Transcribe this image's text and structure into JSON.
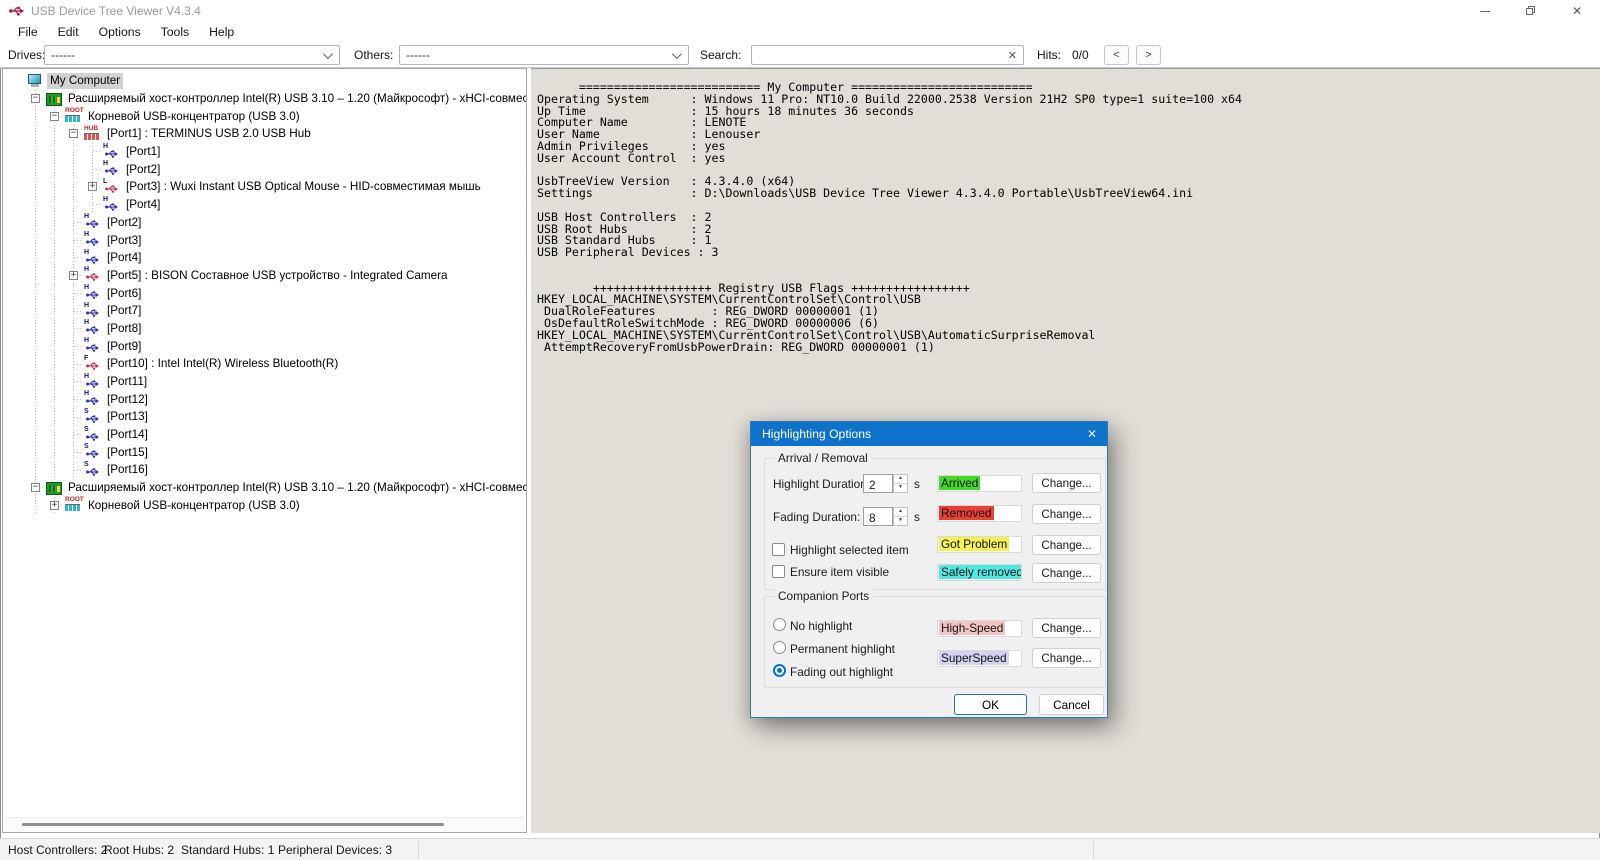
{
  "window": {
    "title": "USB Device Tree Viewer V4.3.4"
  },
  "menu": [
    "File",
    "Edit",
    "Options",
    "Tools",
    "Help"
  ],
  "toolbar": {
    "drives_label": "Drives:",
    "drives_value": "------",
    "others_label": "Others:",
    "others_value": "------",
    "search_label": "Search:",
    "search_value": "",
    "clear_icon": "✕",
    "hits_label": "Hits:",
    "hits_value": "0/0",
    "prev_label": "<",
    "next_label": ">"
  },
  "tree": {
    "items": [
      {
        "level": 0,
        "icon": "computer",
        "expand": null,
        "label": "My Computer",
        "selected": true
      },
      {
        "level": 1,
        "icon": "host-controller",
        "expand": "-",
        "label": "Расширяемый хост-контроллер Intel(R) USB 3.10 – 1.20 (Майкрософт) - xHCI-совместимый хо"
      },
      {
        "level": 2,
        "icon": "root-hub",
        "expand": "-",
        "label": "Корневой USB-концентратор (USB 3.0)"
      },
      {
        "level": 3,
        "icon": "hub",
        "expand": "-",
        "label": "[Port1] : TERMINUS USB 2.0 USB Hub"
      },
      {
        "level": 4,
        "icon": "port-h",
        "expand": null,
        "label": "[Port1]"
      },
      {
        "level": 4,
        "icon": "port-h",
        "expand": null,
        "label": "[Port2]"
      },
      {
        "level": 4,
        "icon": "port-l-device",
        "expand": "+",
        "label": "[Port3] : Wuxi Instant USB Optical Mouse - HID-совместимая мышь"
      },
      {
        "level": 4,
        "icon": "port-h",
        "expand": null,
        "label": "[Port4]"
      },
      {
        "level": 3,
        "icon": "port-h",
        "expand": null,
        "label": "[Port2]"
      },
      {
        "level": 3,
        "icon": "port-h",
        "expand": null,
        "label": "[Port3]"
      },
      {
        "level": 3,
        "icon": "port-h",
        "expand": null,
        "label": "[Port4]"
      },
      {
        "level": 3,
        "icon": "port-h-device",
        "expand": "+",
        "label": "[Port5] : BISON Составное USB устройство - Integrated Camera"
      },
      {
        "level": 3,
        "icon": "port-h",
        "expand": null,
        "label": "[Port6]"
      },
      {
        "level": 3,
        "icon": "port-h",
        "expand": null,
        "label": "[Port7]"
      },
      {
        "level": 3,
        "icon": "port-h",
        "expand": null,
        "label": "[Port8]"
      },
      {
        "level": 3,
        "icon": "port-h",
        "expand": null,
        "label": "[Port9]"
      },
      {
        "level": 3,
        "icon": "port-f-device",
        "expand": null,
        "label": "[Port10] : Intel Intel(R) Wireless Bluetooth(R)"
      },
      {
        "level": 3,
        "icon": "port-h",
        "expand": null,
        "label": "[Port11]"
      },
      {
        "level": 3,
        "icon": "port-h",
        "expand": null,
        "label": "[Port12]"
      },
      {
        "level": 3,
        "icon": "port-s",
        "expand": null,
        "label": "[Port13]"
      },
      {
        "level": 3,
        "icon": "port-s",
        "expand": null,
        "label": "[Port14]"
      },
      {
        "level": 3,
        "icon": "port-s",
        "expand": null,
        "label": "[Port15]"
      },
      {
        "level": 3,
        "icon": "port-s",
        "expand": null,
        "label": "[Port16]"
      },
      {
        "level": 1,
        "icon": "host-controller",
        "expand": "-",
        "label": "Расширяемый хост-контроллер Intel(R) USB 3.10 – 1.20 (Майкрософт) - xHCI-совместимый хо"
      },
      {
        "level": 2,
        "icon": "root-hub",
        "expand": "+",
        "label": "Корневой USB-концентратор (USB 3.0)"
      }
    ]
  },
  "terminal": {
    "lines": [
      "      ========================== My Computer ==========================",
      "Operating System      : Windows 11 Pro: NT10.0 Build 22000.2538 Version 21H2 SP0 type=1 suite=100 x64",
      "Up Time               : 15 hours 18 minutes 36 seconds",
      "Computer Name         : LENOTE",
      "User Name             : Lenouser",
      "Admin Privileges      : yes",
      "User Account Control  : yes",
      "",
      "UsbTreeView Version   : 4.3.4.0 (x64)",
      "Settings              : D:\\Downloads\\USB Device Tree Viewer 4.3.4.0 Portable\\UsbTreeView64.ini",
      "",
      "USB Host Controllers  : 2",
      "USB Root Hubs         : 2",
      "USB Standard Hubs     : 1",
      "USB Peripheral Devices : 3",
      "",
      "",
      "        +++++++++++++++++ Registry USB Flags +++++++++++++++++",
      "HKEY_LOCAL_MACHINE\\SYSTEM\\CurrentControlSet\\Control\\USB",
      " DualRoleFeatures        : REG_DWORD 00000001 (1)",
      " OsDefaultRoleSwitchMode : REG_DWORD 00000006 (6)",
      "HKEY_LOCAL_MACHINE\\SYSTEM\\CurrentControlSet\\Control\\USB\\AutomaticSurpriseRemoval",
      " AttemptRecoveryFromUsbPowerDrain: REG_DWORD 00000001 (1)"
    ]
  },
  "dialog": {
    "title": "Highlighting Options",
    "close_icon": "✕",
    "group1": "Arrival / Removal",
    "group2": "Companion Ports",
    "highlight_duration_label": "Highlight Duration:",
    "highlight_duration_value": "2",
    "fading_duration_label": "Fading Duration:",
    "fading_duration_value": "8",
    "seconds_suffix": "s",
    "checkboxes": [
      {
        "label": "Highlight selected item",
        "checked": false
      },
      {
        "label": "Ensure item visible",
        "checked": false
      }
    ],
    "radios": [
      {
        "label": "No highlight",
        "selected": false
      },
      {
        "label": "Permanent highlight",
        "selected": false
      },
      {
        "label": "Fading out highlight",
        "selected": true
      }
    ],
    "highlights": [
      {
        "label": "Arrived",
        "color": "#42d929"
      },
      {
        "label": "Removed",
        "color": "#ea3e36"
      },
      {
        "label": "Got Problem",
        "color": "#f4f152"
      },
      {
        "label": "Safely removed",
        "color": "#4fe9e1"
      },
      {
        "label": "High-Speed",
        "color": "#f2c5c3"
      },
      {
        "label": "SuperSpeed",
        "color": "#d3d3f1"
      }
    ],
    "change_label": "Change...",
    "ok_label": "OK",
    "cancel_label": "Cancel"
  },
  "statusbar": {
    "items": [
      "Host Controllers: 2",
      "Root Hubs: 2",
      "Standard Hubs: 1",
      "Peripheral Devices: 3"
    ]
  }
}
